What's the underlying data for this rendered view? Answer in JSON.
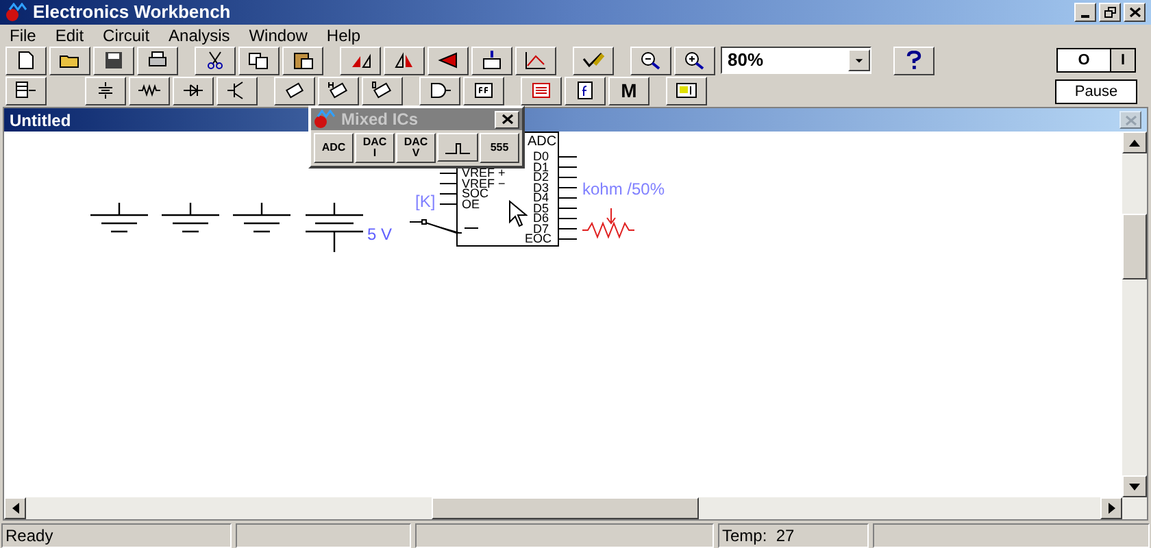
{
  "window": {
    "title": "Electronics Workbench"
  },
  "menu": [
    "File",
    "Edit",
    "Circuit",
    "Analysis",
    "Window",
    "Help"
  ],
  "toolbar": {
    "zoom": "80%",
    "macro_button": "M"
  },
  "power": {
    "off": "O",
    "on": "I",
    "switched_on": false,
    "pause": "Pause"
  },
  "document": {
    "title": "Untitled"
  },
  "palette": {
    "title": "Mixed ICs",
    "buttons": [
      {
        "kind": "text",
        "label": "ADC"
      },
      {
        "kind": "text",
        "label": "DAC I"
      },
      {
        "kind": "text",
        "label": "DAC V"
      },
      {
        "kind": "pulse"
      },
      {
        "kind": "text",
        "label": "555"
      }
    ]
  },
  "circuit": {
    "source_label": "5 V",
    "ic": {
      "title": "ADC",
      "left_pins": [
        "VREF +",
        "VREF −",
        "SOC",
        "OE"
      ],
      "right_pins": [
        "D0",
        "D1",
        "D2",
        "D3",
        "D4",
        "D5",
        "D6",
        "D7",
        "EOC"
      ]
    },
    "pot_label_left": "[K]",
    "pot_label_right": "kohm /50%"
  },
  "status_bar": {
    "message": "Ready",
    "temperature": "Temp:  27"
  }
}
